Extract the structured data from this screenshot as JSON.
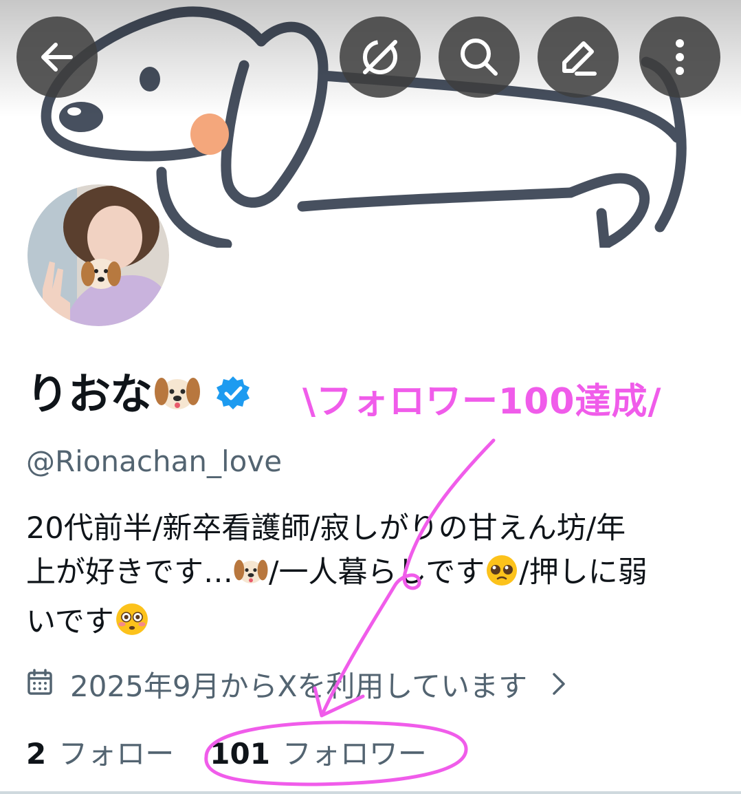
{
  "topbar": {
    "back": "arrow-left-icon",
    "grok": "grok-icon",
    "search": "search-icon",
    "edit": "edit-pen-icon",
    "more": "more-vertical-icon"
  },
  "profile": {
    "display_name": "りおな",
    "name_emoji": "dog-face-emoji",
    "verified": "verified-badge-icon",
    "handle": "@Rionachan_love",
    "bio": {
      "line1": "20代前半/新卒看護師/寂しがりの甘えん坊/年",
      "line2a": "上が好きです…",
      "line2b": "/一人暮らしです",
      "line2c": "/押しに弱",
      "line3": "いです"
    },
    "joined": "2025年9月からXを利用しています",
    "following_count": "2",
    "following_label": "フォロー",
    "followers_count": "101",
    "followers_label": "フォロワー"
  },
  "annotation": {
    "text": "\\フォロワー100達成/",
    "color": "#f05cea"
  },
  "colors": {
    "text": "#0f1419",
    "secondary": "#536471",
    "verified": "#1d9bf0",
    "dog_line": "#47505f",
    "dog_cheek": "#f4a77c",
    "annotation": "#f05cea"
  }
}
